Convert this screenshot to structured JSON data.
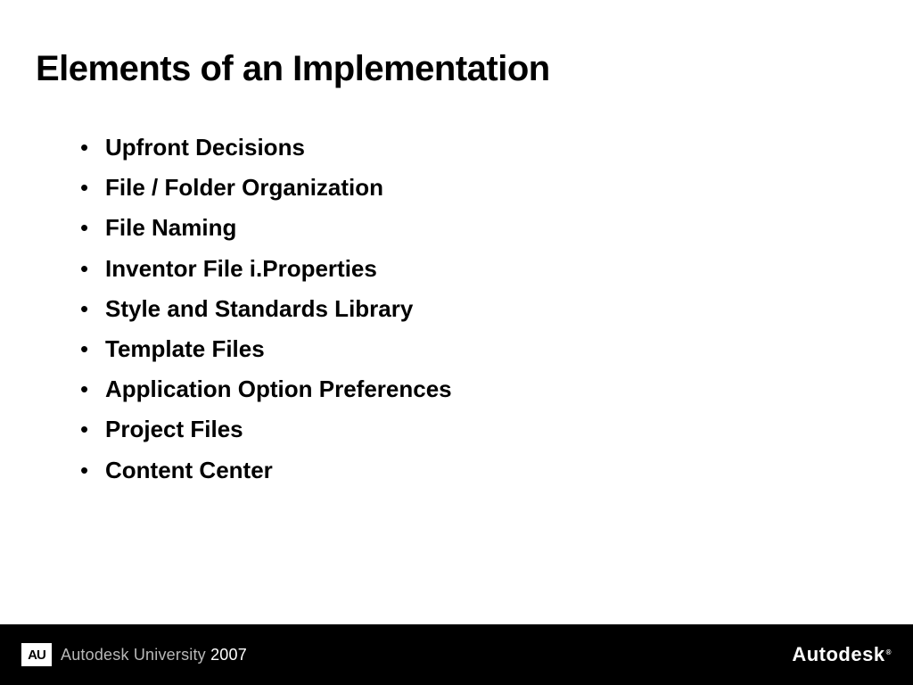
{
  "slide": {
    "title": "Elements of an Implementation",
    "bullets": [
      "Upfront Decisions",
      "File / Folder Organization",
      "File Naming",
      "Inventor File i.Properties",
      "Style and Standards Library",
      "Template Files",
      "Application Option Preferences",
      "Project Files",
      "Content Center"
    ]
  },
  "footer": {
    "badge": "AU",
    "left_text": "Autodesk University ",
    "year": "2007",
    "right_text": "Autodesk"
  }
}
